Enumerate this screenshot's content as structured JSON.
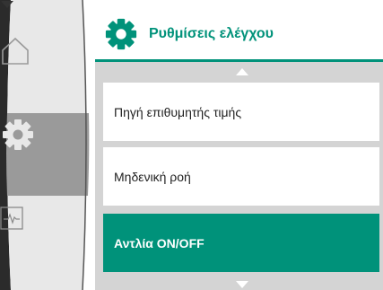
{
  "header": {
    "icon": "gear-icon",
    "title": "Ρυθμίσεις ελέγχου"
  },
  "sidebar": {
    "items": [
      {
        "icon": "home-icon",
        "active": false
      },
      {
        "icon": "gear-icon",
        "active": true
      },
      {
        "icon": "monitor-icon",
        "active": false
      }
    ]
  },
  "menu": {
    "items": [
      {
        "label": "Πηγή επιθυμητής τιμής",
        "selected": false
      },
      {
        "label": "Μηδενική ροή",
        "selected": false
      },
      {
        "label": "Αντλία ON/OFF",
        "selected": true
      }
    ]
  },
  "colors": {
    "accent": "#00927a",
    "rail_dark": "#2b2b2b",
    "rail_light": "#e8e8e8",
    "rail_active": "#9a9a9a",
    "panel": "#d4d4d4"
  }
}
